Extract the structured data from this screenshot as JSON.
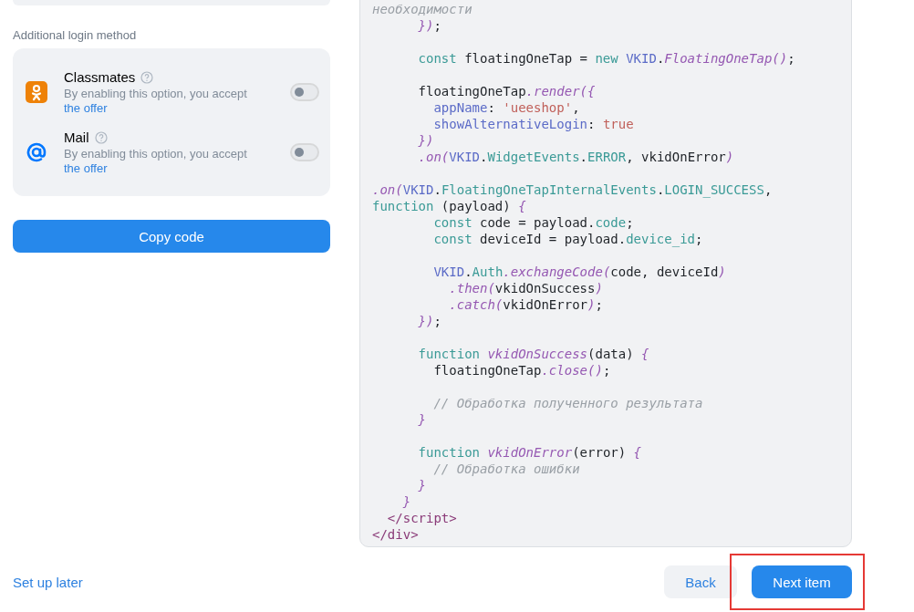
{
  "additional_login": {
    "heading": "Additional login method",
    "methods": [
      {
        "kind": "ok",
        "name": "Classmates",
        "note": "By enabling this option, you accept",
        "link": "the offer",
        "on": false
      },
      {
        "kind": "mail",
        "name": "Mail",
        "note": "By enabling this option, you accept",
        "link": "the offer",
        "on": false
      }
    ]
  },
  "copy_button": "Copy code",
  "code": [
    {
      "kind": "line",
      "tokens": [
        {
          "kind": "comment",
          "text": "необходимости"
        }
      ]
    },
    {
      "kind": "line",
      "tokens": [
        {
          "kind": "fn",
          "text": "      })"
        },
        {
          "kind": "plain",
          "text": ";"
        }
      ]
    },
    {
      "kind": "blank"
    },
    {
      "kind": "line",
      "tokens": [
        {
          "kind": "kw",
          "text": "      const"
        },
        {
          "kind": "plain",
          "text": " floatingOneTap = "
        },
        {
          "kind": "kw",
          "text": "new"
        },
        {
          "kind": "ns",
          "text": " VKID"
        },
        {
          "kind": "plain",
          "text": "."
        },
        {
          "kind": "fn",
          "text": "FloatingOneTap()"
        },
        {
          "kind": "plain",
          "text": ";"
        }
      ]
    },
    {
      "kind": "blank"
    },
    {
      "kind": "line",
      "tokens": [
        {
          "kind": "plain",
          "text": "      floatingOneTap"
        },
        {
          "kind": "fn",
          "text": ".render({"
        }
      ]
    },
    {
      "kind": "line",
      "tokens": [
        {
          "kind": "ns",
          "text": "        appName"
        },
        {
          "kind": "plain",
          "text": ": "
        },
        {
          "kind": "str",
          "text": "'ueeshop'"
        },
        {
          "kind": "plain",
          "text": ","
        }
      ]
    },
    {
      "kind": "line",
      "tokens": [
        {
          "kind": "ns",
          "text": "        showAlternativeLogin"
        },
        {
          "kind": "plain",
          "text": ": "
        },
        {
          "kind": "str",
          "text": "true"
        }
      ]
    },
    {
      "kind": "line",
      "tokens": [
        {
          "kind": "fn",
          "text": "      })"
        }
      ]
    },
    {
      "kind": "line",
      "tokens": [
        {
          "kind": "fn",
          "text": "      .on("
        },
        {
          "kind": "ns",
          "text": "VKID"
        },
        {
          "kind": "plain",
          "text": "."
        },
        {
          "kind": "kw",
          "text": "WidgetEvents"
        },
        {
          "kind": "plain",
          "text": "."
        },
        {
          "kind": "kw",
          "text": "ERROR"
        },
        {
          "kind": "plain",
          "text": ", vkidOnError"
        },
        {
          "kind": "fn",
          "text": ")"
        }
      ]
    },
    {
      "kind": "blank"
    },
    {
      "kind": "line",
      "tokens": [
        {
          "kind": "fn",
          "text": ".on("
        },
        {
          "kind": "ns",
          "text": "VKID"
        },
        {
          "kind": "plain",
          "text": "."
        },
        {
          "kind": "kw",
          "text": "FloatingOneTapInternalEvents"
        },
        {
          "kind": "plain",
          "text": "."
        },
        {
          "kind": "kw",
          "text": "LOGIN_SUCCESS"
        },
        {
          "kind": "plain",
          "text": ","
        }
      ]
    },
    {
      "kind": "line",
      "tokens": [
        {
          "kind": "kw",
          "text": "function"
        },
        {
          "kind": "plain",
          "text": " (payload) "
        },
        {
          "kind": "fn",
          "text": "{"
        }
      ]
    },
    {
      "kind": "line",
      "tokens": [
        {
          "kind": "kw",
          "text": "        const"
        },
        {
          "kind": "plain",
          "text": " code = payload."
        },
        {
          "kind": "kw",
          "text": "code"
        },
        {
          "kind": "plain",
          "text": ";"
        }
      ]
    },
    {
      "kind": "line",
      "tokens": [
        {
          "kind": "kw",
          "text": "        const"
        },
        {
          "kind": "plain",
          "text": " deviceId = payload."
        },
        {
          "kind": "kw",
          "text": "device_id"
        },
        {
          "kind": "plain",
          "text": ";"
        }
      ]
    },
    {
      "kind": "blank"
    },
    {
      "kind": "line",
      "tokens": [
        {
          "kind": "ns",
          "text": "        VKID"
        },
        {
          "kind": "plain",
          "text": "."
        },
        {
          "kind": "kw",
          "text": "Auth"
        },
        {
          "kind": "fn",
          "text": ".exchangeCode("
        },
        {
          "kind": "plain",
          "text": "code, deviceId"
        },
        {
          "kind": "fn",
          "text": ")"
        }
      ]
    },
    {
      "kind": "line",
      "tokens": [
        {
          "kind": "fn",
          "text": "          .then("
        },
        {
          "kind": "plain",
          "text": "vkidOnSuccess"
        },
        {
          "kind": "fn",
          "text": ")"
        }
      ]
    },
    {
      "kind": "line",
      "tokens": [
        {
          "kind": "fn",
          "text": "          .catch("
        },
        {
          "kind": "plain",
          "text": "vkidOnError"
        },
        {
          "kind": "fn",
          "text": ")"
        },
        {
          "kind": "plain",
          "text": ";"
        }
      ]
    },
    {
      "kind": "line",
      "tokens": [
        {
          "kind": "fn",
          "text": "      })"
        },
        {
          "kind": "plain",
          "text": ";"
        }
      ]
    },
    {
      "kind": "blank"
    },
    {
      "kind": "line",
      "tokens": [
        {
          "kind": "kw",
          "text": "      function"
        },
        {
          "kind": "fn",
          "text": " vkidOnSuccess"
        },
        {
          "kind": "plain",
          "text": "(data) "
        },
        {
          "kind": "fn",
          "text": "{"
        }
      ]
    },
    {
      "kind": "line",
      "tokens": [
        {
          "kind": "plain",
          "text": "        floatingOneTap"
        },
        {
          "kind": "fn",
          "text": ".close()"
        },
        {
          "kind": "plain",
          "text": ";"
        }
      ]
    },
    {
      "kind": "blank"
    },
    {
      "kind": "line",
      "tokens": [
        {
          "kind": "comment",
          "text": "        // Обработка полученного результата"
        }
      ]
    },
    {
      "kind": "line",
      "tokens": [
        {
          "kind": "fn",
          "text": "      }"
        }
      ]
    },
    {
      "kind": "blank"
    },
    {
      "kind": "line",
      "tokens": [
        {
          "kind": "kw",
          "text": "      function"
        },
        {
          "kind": "fn",
          "text": " vkidOnError"
        },
        {
          "kind": "plain",
          "text": "(error) "
        },
        {
          "kind": "fn",
          "text": "{"
        }
      ]
    },
    {
      "kind": "line",
      "tokens": [
        {
          "kind": "comment",
          "text": "        // Обработка ошибки"
        }
      ]
    },
    {
      "kind": "line",
      "tokens": [
        {
          "kind": "fn",
          "text": "      }"
        }
      ]
    },
    {
      "kind": "line",
      "tokens": [
        {
          "kind": "fn",
          "text": "    }"
        }
      ]
    },
    {
      "kind": "line",
      "tokens": [
        {
          "kind": "tag",
          "text": "  </script>"
        }
      ]
    },
    {
      "kind": "line",
      "tokens": [
        {
          "kind": "tag",
          "text": "</div>"
        }
      ]
    }
  ],
  "footer": {
    "skip_link": "Set up later",
    "back_button": "Back",
    "next_button": "Next item"
  }
}
